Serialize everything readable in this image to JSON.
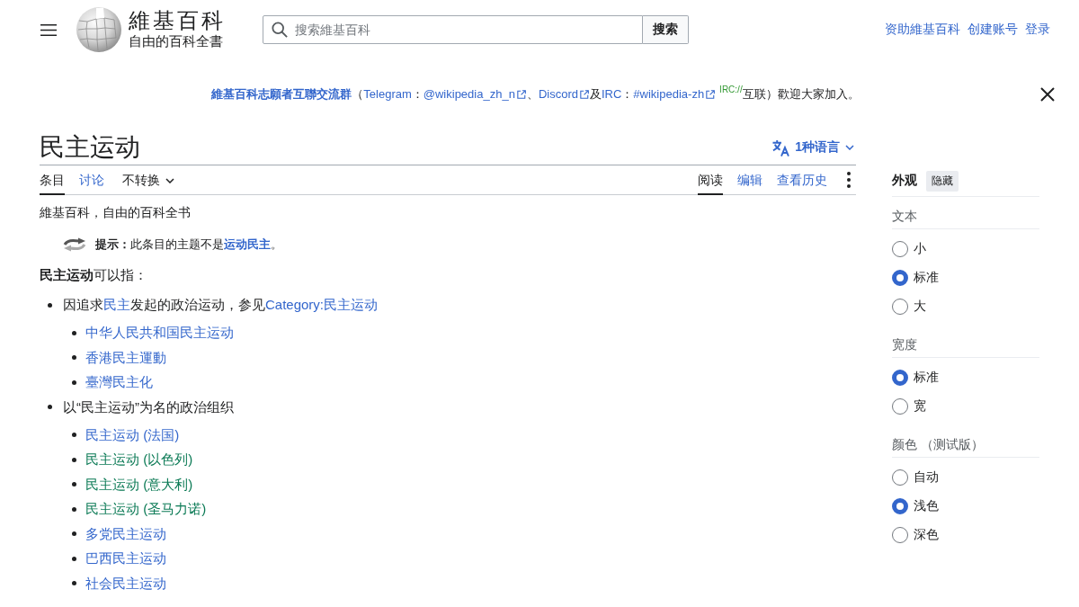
{
  "header": {
    "site_name": "維基百科",
    "tagline": "自由的百科全書",
    "search": {
      "placeholder": "搜索維基百科",
      "button": "搜索"
    },
    "user_links": [
      "资助維基百科",
      "创建账号",
      "登录"
    ]
  },
  "banner": {
    "segments": [
      {
        "kind": "bold-link",
        "text": "維基百科志願者互聯交流群"
      },
      {
        "kind": "text",
        "text": "（"
      },
      {
        "kind": "link",
        "text": "Telegram"
      },
      {
        "kind": "text",
        "text": "："
      },
      {
        "kind": "ext-link",
        "text": "@wikipedia_zh_n"
      },
      {
        "kind": "text",
        "text": "、"
      },
      {
        "kind": "ext-link",
        "text": "Discord"
      },
      {
        "kind": "text",
        "text": "及"
      },
      {
        "kind": "link",
        "text": "IRC"
      },
      {
        "kind": "text",
        "text": "："
      },
      {
        "kind": "ext-link",
        "text": "#wikipedia-zh"
      },
      {
        "kind": "sup-link",
        "text": "IRC://"
      },
      {
        "kind": "text",
        "text": "互联）歡迎大家加入。"
      }
    ]
  },
  "article": {
    "title": "民主运动",
    "languages_button": "1种语言",
    "left_tabs": [
      {
        "label": "条目",
        "selected": true,
        "kind": "tab"
      },
      {
        "label": "讨论",
        "selected": false,
        "kind": "tab"
      },
      {
        "label": "不转换",
        "selected": false,
        "kind": "dropdown"
      }
    ],
    "right_tabs": [
      {
        "label": "阅读",
        "selected": true
      },
      {
        "label": "编辑",
        "selected": false
      },
      {
        "label": "查看历史",
        "selected": false
      }
    ],
    "site_subtitle": "維基百科，自由的百科全书",
    "hatnote": [
      {
        "kind": "bold",
        "text": "提示："
      },
      {
        "kind": "text",
        "text": "此条目的主题不是"
      },
      {
        "kind": "bold-link",
        "text": "运动民主"
      },
      {
        "kind": "text",
        "text": "。"
      }
    ],
    "lead": "**民主运动**可以指：",
    "list": [
      {
        "segments": [
          {
            "kind": "text",
            "text": "因追求"
          },
          {
            "kind": "link",
            "text": "民主"
          },
          {
            "kind": "text",
            "text": "发起的政治运动，参见"
          },
          {
            "kind": "link",
            "text": "Category:民主运动"
          }
        ],
        "children": [
          {
            "text": "中华人民共和国民主运动",
            "color": "#3366cc"
          },
          {
            "text": "香港民主運動",
            "color": "#3366cc"
          },
          {
            "text": "臺灣民主化",
            "color": "#3366cc"
          }
        ]
      },
      {
        "segments": [
          {
            "kind": "text",
            "text": "以“民主运动”为名的政治组织"
          }
        ],
        "children": [
          {
            "text": "民主运动 (法国)",
            "color": "#3366cc"
          },
          {
            "text": "民主运动 (以色列)",
            "color": "#0b7a55"
          },
          {
            "text": "民主运动 (意大利)",
            "color": "#0b7a55"
          },
          {
            "text": "民主运动 (圣马力诺)",
            "color": "#0b7a55"
          },
          {
            "text": "多党民主运动",
            "color": "#3366cc"
          },
          {
            "text": "巴西民主运动",
            "color": "#3366cc"
          },
          {
            "text": "社会民主运动",
            "color": "#3366cc"
          }
        ]
      }
    ]
  },
  "appearance": {
    "title": "外观",
    "hide_button": "隐藏",
    "groups": [
      {
        "label": "文本",
        "options": [
          {
            "label": "小",
            "selected": false
          },
          {
            "label": "标准",
            "selected": true
          },
          {
            "label": "大",
            "selected": false
          }
        ]
      },
      {
        "label": "宽度",
        "options": [
          {
            "label": "标准",
            "selected": true
          },
          {
            "label": "宽",
            "selected": false
          }
        ]
      },
      {
        "label": "颜色 （测试版）",
        "options": [
          {
            "label": "自动",
            "selected": false
          },
          {
            "label": "浅色",
            "selected": true
          },
          {
            "label": "深色",
            "selected": false
          }
        ]
      }
    ]
  }
}
